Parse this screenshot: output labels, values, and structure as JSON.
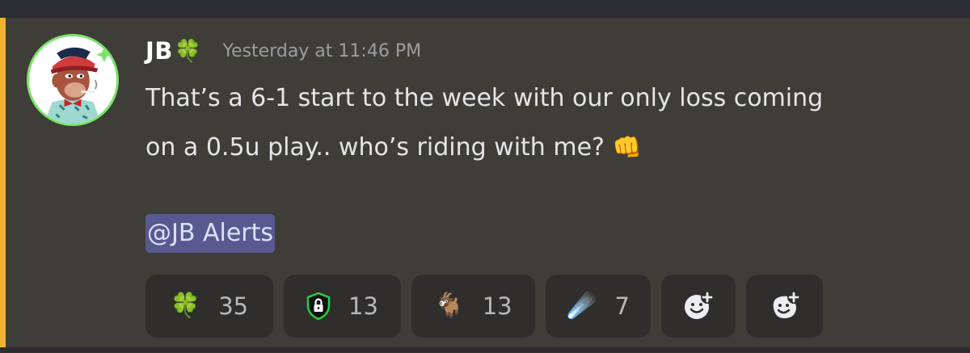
{
  "message": {
    "author": "JB",
    "author_badge_emoji": "🍀",
    "timestamp": "Yesterday at 11:46 PM",
    "content_line_1": "That’s a 6-1 start to the week with our only loss coming",
    "content_line_2": "on a 0.5u play.. who’s riding with me?",
    "content_emoji": "👊",
    "mention": "@JB Alerts",
    "highlight_color": "#f0b232"
  },
  "reactions": [
    {
      "emoji": "🍀",
      "count": "35"
    },
    {
      "icon": "shield-lock-icon",
      "count": "13"
    },
    {
      "emoji": "🐐",
      "count": "13"
    },
    {
      "emoji": "☄️",
      "count": "7"
    }
  ],
  "actions": [
    {
      "icon": "add-reaction-icon"
    },
    {
      "icon": "add-super-reaction-icon"
    }
  ]
}
